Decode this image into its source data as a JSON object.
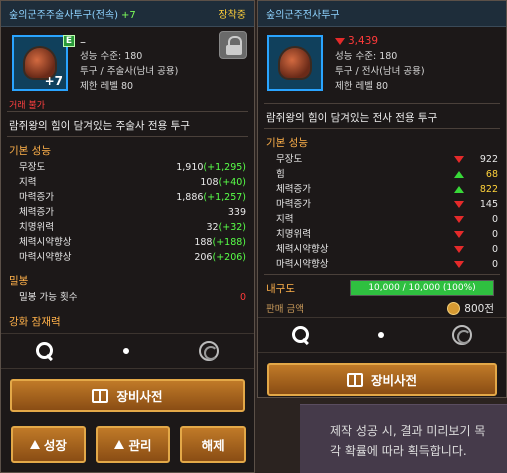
{
  "left": {
    "title": "숲의군주주술사투구(전속)",
    "enhance": "+7",
    "equipped": "장착중",
    "badge": "E",
    "plus_level": "+7",
    "name_dash": "–",
    "meta": [
      "성능 수준: 180",
      "투구 / 주술사(남녀 공용)",
      "제한 레벨 80"
    ],
    "trade": "거래 불가",
    "desc": "람쥐왕의 힘이 담겨있는 주술사 전용 투구",
    "base_title": "기본 성능",
    "stats": [
      {
        "name": "무장도",
        "value": "1,910",
        "bonus": "(+1,295)"
      },
      {
        "name": "지력",
        "value": "108",
        "bonus": "(+40)"
      },
      {
        "name": "마력증가",
        "value": "1,886",
        "bonus": "(+1,257)"
      },
      {
        "name": "체력증가",
        "value": "339",
        "bonus": ""
      },
      {
        "name": "치명위력",
        "value": "32",
        "bonus": "(+32)"
      },
      {
        "name": "체력시약향상",
        "value": "188",
        "bonus": "(+188)"
      },
      {
        "name": "마력시약향상",
        "value": "206",
        "bonus": "(+206)"
      }
    ],
    "seal_title": "밀봉",
    "seal_label": "밀봉 가능 횟수",
    "seal_value": "0",
    "enh_title": "강화 잠재력",
    "dict_label": "장비사전",
    "buttons": [
      "성장",
      "관리",
      "해제"
    ]
  },
  "right": {
    "title": "숲의군주전사투구",
    "price_delta": "3,439",
    "meta": [
      "성능 수준: 180",
      "투구 / 전사(남녀 공용)",
      "제한 레벨 80"
    ],
    "desc": "람쥐왕의 힘이 담겨있는 전사 전용 투구",
    "base_title": "기본 성능",
    "stats": [
      {
        "name": "무장도",
        "dir": "down",
        "value": "922"
      },
      {
        "name": "힘",
        "dir": "up",
        "value": "68"
      },
      {
        "name": "체력증가",
        "dir": "up",
        "value": "822"
      },
      {
        "name": "마력증가",
        "dir": "down",
        "value": "145"
      },
      {
        "name": "지력",
        "dir": "down",
        "value": "0"
      },
      {
        "name": "치명위력",
        "dir": "down",
        "value": "0"
      },
      {
        "name": "체력시약향상",
        "dir": "down",
        "value": "0"
      },
      {
        "name": "마력시약향상",
        "dir": "down",
        "value": "0"
      }
    ],
    "durability_label": "내구도",
    "durability_text": "10,000 / 10,000 (100%)",
    "durability_fraction": 1.0,
    "sell_label": "판매 금액",
    "sell_value": "800전",
    "dict_label": "장비사전"
  },
  "bg_tooltip": [
    "제작 성공 시, 결과 미리보기 목",
    "각 확률에 따라 획득합니다."
  ],
  "colors": {
    "accent_green": "#58ff48",
    "accent_red": "#ff3a3a",
    "title_blue": "#8fd3ff",
    "section_orange": "#ffb14a"
  }
}
